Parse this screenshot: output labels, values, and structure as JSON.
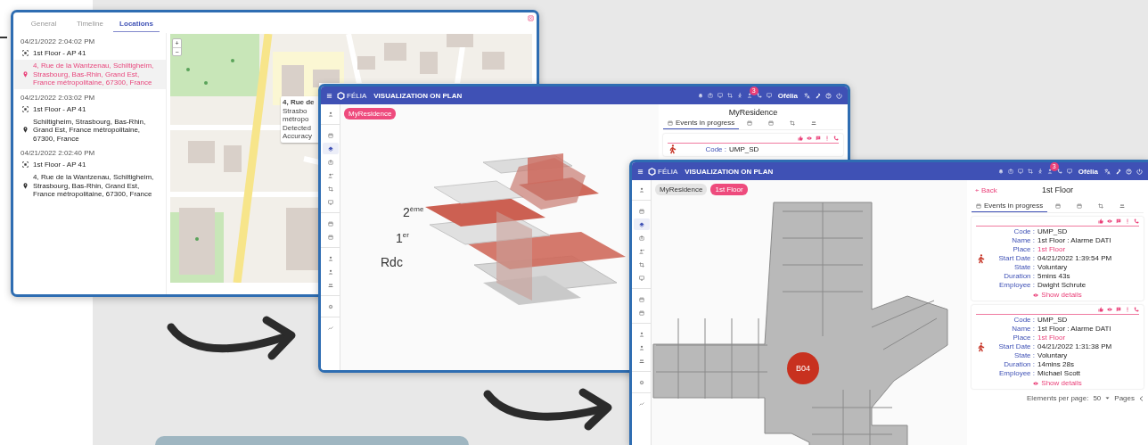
{
  "locations_window": {
    "tabs": [
      {
        "label": "General",
        "selected": false
      },
      {
        "label": "Timeline",
        "selected": false
      },
      {
        "label": "Locations",
        "selected": true
      }
    ],
    "entries": [
      {
        "time": "04/21/2022 2:04:02 PM",
        "zone": "1st Floor - AP 41",
        "address": "4, Rue de la Wantzenau, Schiltigheim, Strasbourg, Bas-Rhin, Grand Est, France métropolitaine, 67300, France",
        "selected": true
      },
      {
        "time": "04/21/2022 2:03:02 PM",
        "zone": "1st Floor - AP 41",
        "address": "Schiltigheim, Strasbourg, Bas-Rhin, Grand Est, France métropolitaine, 67300, France",
        "selected": false
      },
      {
        "time": "04/21/2022 2:02:40 PM",
        "zone": "1st Floor - AP 41",
        "address": "4, Rue de la Wantzenau, Schiltigheim, Strasbourg, Bas-Rhin, Grand Est, France métropolitaine, 67300, France",
        "selected": false
      }
    ],
    "map": {
      "zoom_in": "+",
      "zoom_out": "−",
      "popup": [
        "4, Rue de",
        "Strasbo",
        "métropo",
        "Detected",
        "Accuracy"
      ]
    }
  },
  "plan_windows": [
    {
      "header": {
        "logo": "FÉLIA",
        "title": "VISUALIZATION ON PLAN",
        "badge": "3",
        "user": "Ofélia"
      },
      "sidebar": [
        {
          "selected": false
        },
        {
          "selected": false
        },
        {
          "selected": true
        },
        {
          "selected": false
        },
        {
          "selected": false
        },
        {
          "selected": false
        },
        {
          "selected": false
        },
        {
          "selected": false
        },
        {
          "selected": false
        },
        {
          "selected": false
        },
        {
          "selected": false
        },
        {
          "selected": false
        },
        {
          "selected": false
        },
        {
          "selected": false
        }
      ],
      "chips": [
        {
          "label": "MyResidence",
          "selected": true
        }
      ],
      "view": {
        "kind": "building",
        "levels": [
          "2$^{ème}$",
          "1$^{er}$",
          "Rdc"
        ]
      },
      "panel": {
        "title": "MyResidence",
        "tabs": [
          {
            "label": "Events in progress",
            "selected": true
          },
          {
            "selected": false
          },
          {
            "selected": false
          },
          {
            "selected": false
          },
          {
            "selected": false
          }
        ],
        "cards": [
          {
            "fields": [
              {
                "label": "Code :",
                "value": "UMP_SD",
                "accent": false
              }
            ]
          }
        ]
      }
    },
    {
      "header": {
        "logo": "FÉLIA",
        "title": "VISUALIZATION ON PLAN",
        "badge": "3",
        "user": "Ofélia"
      },
      "sidebar": [
        {
          "selected": false
        },
        {
          "selected": false
        },
        {
          "selected": true
        },
        {
          "selected": false
        },
        {
          "selected": false
        },
        {
          "selected": false
        },
        {
          "selected": false
        },
        {
          "selected": false
        },
        {
          "selected": false
        },
        {
          "selected": false
        },
        {
          "selected": false
        },
        {
          "selected": false
        },
        {
          "selected": false
        },
        {
          "selected": false
        }
      ],
      "chips": [
        {
          "label": "MyResidence",
          "selected": false
        },
        {
          "label": "1st Floor",
          "selected": true
        }
      ],
      "view": {
        "kind": "floor",
        "marker": "B04"
      },
      "panel": {
        "back": "Back",
        "title": "1st Floor",
        "tabs": [
          {
            "label": "Events in progress",
            "selected": true
          },
          {
            "selected": false
          },
          {
            "selected": false
          },
          {
            "selected": false
          },
          {
            "selected": false
          }
        ],
        "cards": [
          {
            "fields": [
              {
                "label": "Code :",
                "value": "UMP_SD",
                "accent": false
              },
              {
                "label": "Name :",
                "value": "1st Floor : Alarme DATI",
                "accent": false
              },
              {
                "label": "Place :",
                "value": "1st Floor",
                "accent": true
              },
              {
                "label": "Start Date :",
                "value": "04/21/2022 1:39:54 PM",
                "accent": false
              },
              {
                "label": "State :",
                "value": "Voluntary",
                "accent": false
              },
              {
                "label": "Duration :",
                "value": "5mins 43s",
                "accent": false
              },
              {
                "label": "Employee :",
                "value": "Dwight Schrute",
                "accent": false
              }
            ],
            "details": "Show details"
          },
          {
            "fields": [
              {
                "label": "Code :",
                "value": "UMP_SD",
                "accent": false
              },
              {
                "label": "Name :",
                "value": "1st Floor : Alarme DATI",
                "accent": false
              },
              {
                "label": "Place :",
                "value": "1st Floor",
                "accent": true
              },
              {
                "label": "Start Date :",
                "value": "04/21/2022 1:31:38 PM",
                "accent": false
              },
              {
                "label": "State :",
                "value": "Voluntary",
                "accent": false
              },
              {
                "label": "Duration :",
                "value": "14mins 28s",
                "accent": false
              },
              {
                "label": "Employee :",
                "value": "Michael Scott",
                "accent": false
              }
            ],
            "details": "Show details"
          }
        ],
        "pagination": {
          "label": "Elements per page:",
          "size": "50",
          "pages": "Pages"
        }
      }
    }
  ]
}
